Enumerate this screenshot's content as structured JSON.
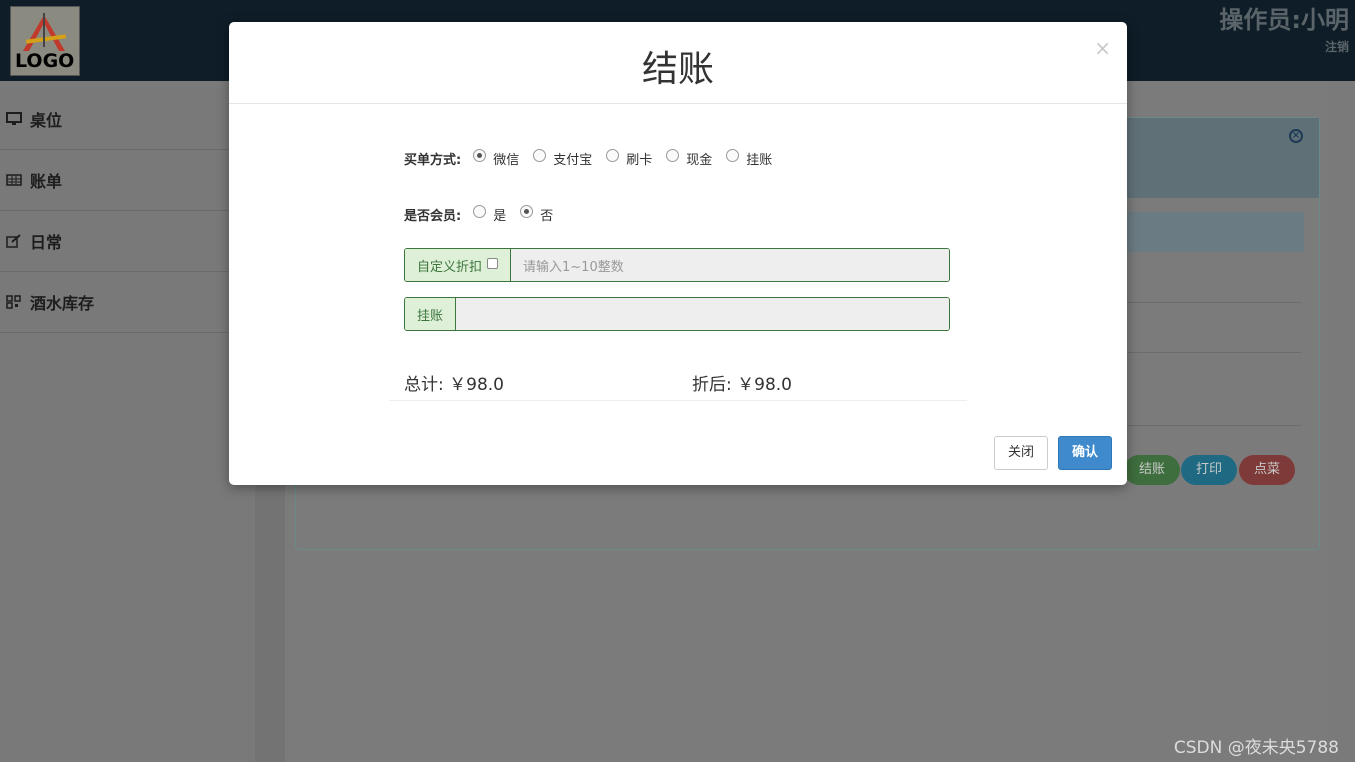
{
  "header": {
    "logo_text": "LOGO",
    "operator": "操作员:小明",
    "logout": "注销"
  },
  "sidebar": {
    "items": [
      {
        "label": "桌位",
        "icon": "monitor-icon"
      },
      {
        "label": "账单",
        "icon": "table-icon"
      },
      {
        "label": "日常",
        "icon": "edit-icon"
      },
      {
        "label": "酒水库存",
        "icon": "qrcode-icon"
      }
    ]
  },
  "background_buttons": {
    "checkout": "结账",
    "print": "打印",
    "order": "点菜"
  },
  "modal": {
    "title": "结账",
    "close_symbol": "×",
    "payment": {
      "label": "买单方式:",
      "options": [
        "微信",
        "支付宝",
        "刷卡",
        "现金",
        "挂账"
      ],
      "selected": "微信"
    },
    "member": {
      "label": "是否会员:",
      "options": [
        "是",
        "否"
      ],
      "selected": "否"
    },
    "discount": {
      "addon_label": "自定义折扣",
      "placeholder": "请输入1~10整数",
      "checked": false
    },
    "credit": {
      "addon_label": "挂账",
      "value": ""
    },
    "total_label": "总计:",
    "total_value": "￥98.0",
    "after_label": "折后:",
    "after_value": "￥98.0",
    "buttons": {
      "close": "关闭",
      "confirm": "确认"
    }
  },
  "watermark": "CSDN @夜未央5788",
  "colors": {
    "topbar": "#0e1d27",
    "success_border": "#3c763d",
    "success_bg": "#dff0d8",
    "primary": "#3e8acc"
  }
}
